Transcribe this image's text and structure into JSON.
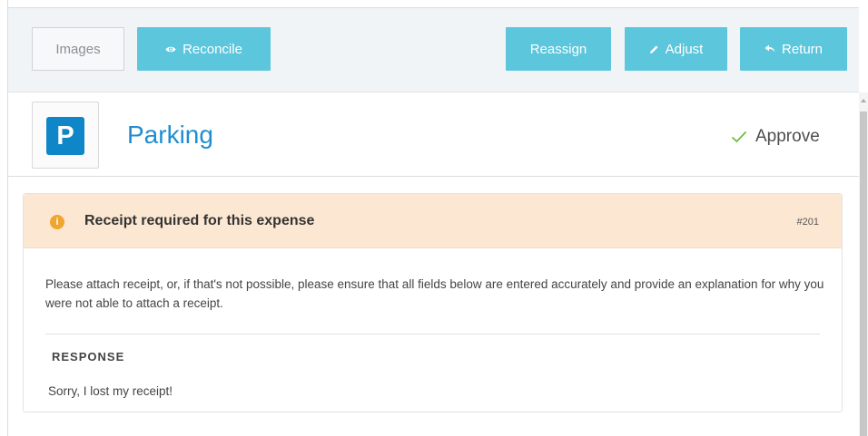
{
  "toolbar": {
    "images_label": "Images",
    "reconcile_label": "Reconcile",
    "reassign_label": "Reassign",
    "adjust_label": "Adjust",
    "return_label": "Return",
    "button_color": "#5bc6dc",
    "icons": {
      "reconcile": "eye-icon",
      "adjust": "pencil-icon",
      "return": "undo-arrow-icon"
    }
  },
  "expense": {
    "category_icon_letter": "P",
    "category_icon_color": "#0f86c7",
    "title": "Parking",
    "approve_label": "Approve",
    "approve_icon": "checkmark-icon",
    "approve_icon_color": "#6cbf3f"
  },
  "notice": {
    "title": "Receipt required for this expense",
    "code": "#201",
    "icon": "info-icon",
    "header_color": "#fce8d2",
    "body": "Please attach receipt, or, if that's not possible, please ensure that all fields below are entered accurately and provide an explanation for why you were not able to attach a receipt.",
    "response_label": "RESPONSE",
    "response_text": "Sorry, I lost my receipt!"
  }
}
